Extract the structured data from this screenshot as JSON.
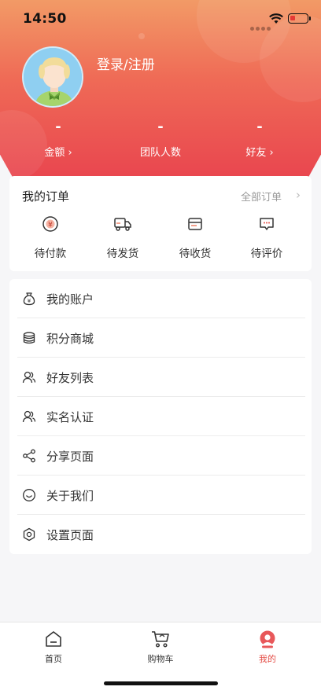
{
  "status": {
    "time": "14:50"
  },
  "header": {
    "login_label": "登录/注册",
    "stats": [
      {
        "value": "-",
        "label": "金额 ›"
      },
      {
        "value": "-",
        "label": "团队人数"
      },
      {
        "value": "-",
        "label": "好友 ›"
      }
    ]
  },
  "orders": {
    "title": "我的订单",
    "all_label": "全部订单",
    "items": [
      {
        "label": "待付款",
        "icon": "yuan-coin-icon"
      },
      {
        "label": "待发货",
        "icon": "truck-icon"
      },
      {
        "label": "待收货",
        "icon": "box-icon"
      },
      {
        "label": "待评价",
        "icon": "comment-icon"
      }
    ]
  },
  "menu": {
    "items": [
      {
        "label": "我的账户",
        "icon": "money-bag-icon"
      },
      {
        "label": "积分商城",
        "icon": "coins-stack-icon"
      },
      {
        "label": "好友列表",
        "icon": "users-icon"
      },
      {
        "label": "实名认证",
        "icon": "user-verify-icon"
      },
      {
        "label": "分享页面",
        "icon": "share-icon"
      },
      {
        "label": "关于我们",
        "icon": "smile-icon"
      },
      {
        "label": "设置页面",
        "icon": "settings-icon"
      }
    ]
  },
  "tabbar": {
    "items": [
      {
        "label": "首页",
        "icon": "home-icon"
      },
      {
        "label": "购物车",
        "icon": "cart-icon"
      },
      {
        "label": "我的",
        "icon": "profile-icon"
      }
    ],
    "active_index": 2
  },
  "colors": {
    "accent": "#e44e47",
    "header_top": "#f29a66",
    "header_bottom": "#e9464f"
  }
}
